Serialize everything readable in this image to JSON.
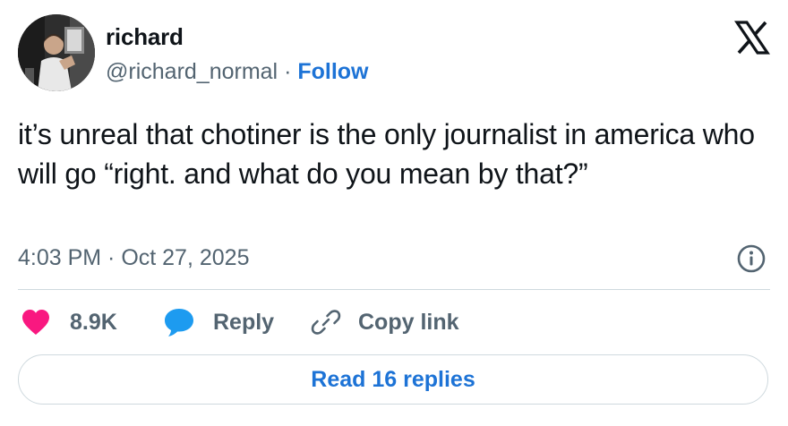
{
  "author": {
    "display_name": "richard",
    "handle": "@richard_normal",
    "separator": " · ",
    "follow_label": "Follow",
    "avatar_icon": "user-avatar-photo"
  },
  "brand": {
    "logo_icon": "x-logo-icon"
  },
  "tweet": {
    "text": "it’s unreal that chotiner is the only journalist in america who will go “right. and what do you mean by that?”",
    "timestamp": "4:03 PM · Oct 27, 2025"
  },
  "actions": {
    "like_count": "8.9K",
    "reply_label": "Reply",
    "copy_link_label": "Copy link"
  },
  "footer": {
    "read_replies_label": "Read 16 replies"
  },
  "colors": {
    "text_primary": "#0f1419",
    "text_secondary": "#536471",
    "link_blue": "#1d73d6",
    "like_pink": "#f91880",
    "reply_blue": "#1d9bf0",
    "border": "#cfd9de"
  }
}
